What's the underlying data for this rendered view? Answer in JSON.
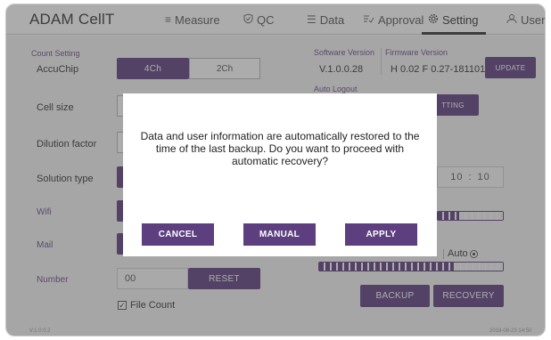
{
  "app": {
    "title": "ADAM CellT"
  },
  "nav": {
    "measure": {
      "label": "Measure",
      "icon": "list-icon"
    },
    "qc": {
      "label": "QC",
      "icon": "shield-icon"
    },
    "data": {
      "label": "Data",
      "icon": "list-icon"
    },
    "approval": {
      "label": "Approval",
      "icon": "approval-icon"
    },
    "setting": {
      "label": "Setting",
      "icon": "gear-icon",
      "active": true
    },
    "user": {
      "label": "User",
      "icon": "user-icon"
    }
  },
  "count_setting": {
    "title": "Count Setting",
    "accuchip": {
      "label": "AccuChip",
      "options": [
        "4Ch",
        "2Ch"
      ],
      "selected": "4Ch"
    },
    "cell_size": {
      "label": "Cell size"
    },
    "dilution_factor": {
      "label": "Dilution factor"
    },
    "solution_type": {
      "label": "Solution type"
    },
    "wifi": {
      "label": "Wifi"
    },
    "mail": {
      "label": "Mail"
    },
    "number": {
      "label": "Number",
      "value": "00",
      "reset_label": "RESET"
    },
    "file_count": {
      "label": "File Count",
      "checked": true
    }
  },
  "version": {
    "software_title": "Software Version",
    "software_value": "V.1.0.0.28",
    "firmware_title": "Firmware Version",
    "firmware_value": "H 0.02 F 0.27-181101",
    "update_label": "UPDATE"
  },
  "auto_logout": {
    "title": "Auto Logout",
    "setting_label": "TTING"
  },
  "time": {
    "hour": "10",
    "sep": ":",
    "minute": "10"
  },
  "brightness": {
    "level": 0.3
  },
  "mode": {
    "auto_label": "Auto",
    "selected": "Auto"
  },
  "volume": {
    "level": 0.72
  },
  "backup": {
    "backup_label": "BACKUP",
    "recovery_label": "RECOVERY"
  },
  "footer": {
    "left": "V.1.0.0.2",
    "right": "2018-08-23 14:50"
  },
  "dialog": {
    "message": "Data and user information are automatically restored to the time of the last backup. Do you want to proceed with automatic recovery?",
    "cancel_label": "CANCEL",
    "manual_label": "MANUAL",
    "apply_label": "APPLY"
  },
  "colors": {
    "accent": "#5d3f80",
    "overlay": "rgba(70,70,70,0.45)"
  }
}
